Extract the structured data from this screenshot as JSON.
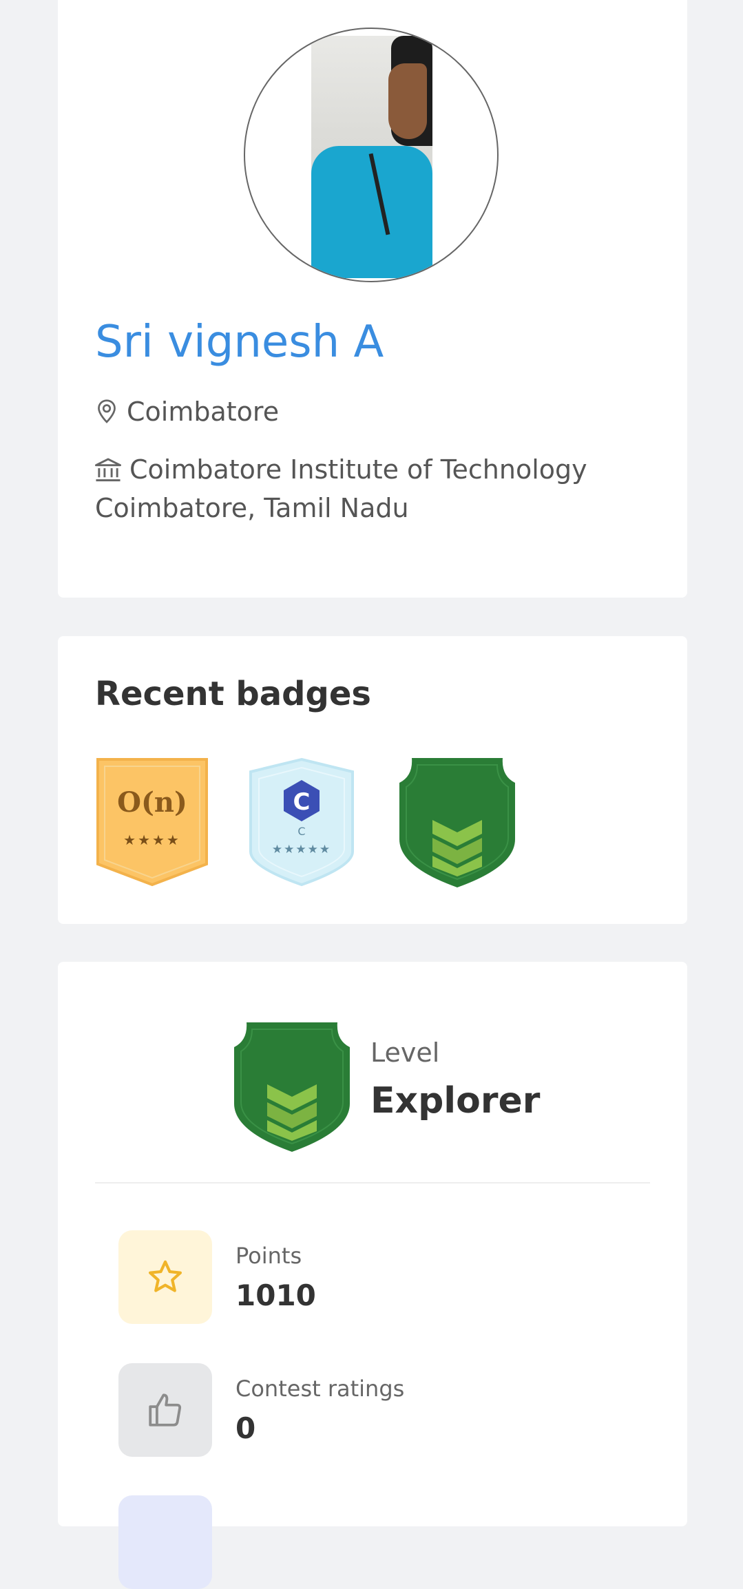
{
  "profile": {
    "name": "Sri vignesh A",
    "city": "Coimbatore",
    "institution_line1": "Coimbatore Institute of Technology",
    "institution_line2": "Coimbatore, Tamil Nadu"
  },
  "badges": {
    "title": "Recent badges",
    "items": [
      {
        "icon": "big-o-badge-icon",
        "label": "O(n)",
        "stars": "★★★★",
        "color": "#fcc465"
      },
      {
        "icon": "c-language-badge-icon",
        "label": "C",
        "sublabel": "C",
        "stars": "★★★★★",
        "color": "#d6f0f8"
      },
      {
        "icon": "explorer-level-badge-icon",
        "color": "#2a7d36"
      }
    ]
  },
  "level": {
    "label": "Level",
    "value": "Explorer"
  },
  "stats": {
    "points_label": "Points",
    "points_value": "1010",
    "contest_label": "Contest ratings",
    "contest_value": "0"
  },
  "colors": {
    "accent": "#3a8de0",
    "background": "#f1f2f4",
    "card": "#ffffff",
    "points_bg": "#fff5d9",
    "contest_bg": "#e6e7e9"
  }
}
